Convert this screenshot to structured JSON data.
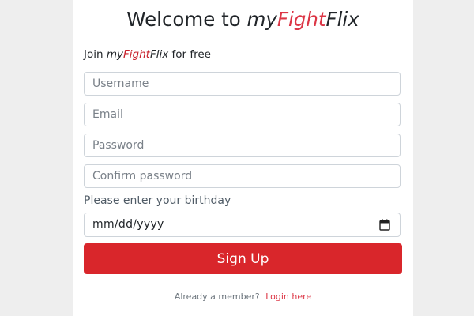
{
  "header": {
    "welcome_text": "Welcome to",
    "brand": {
      "my": "my",
      "fight": "Fight",
      "flix": "Flix"
    }
  },
  "join": {
    "prefix": "Join",
    "brand": {
      "my": "my",
      "fight": "Fight",
      "flix": "Flix"
    },
    "suffix": "for free"
  },
  "form": {
    "username_placeholder": "Username",
    "email_placeholder": "Email",
    "password_placeholder": "Password",
    "confirm_password_placeholder": "Confirm password",
    "birthday_label": "Please enter your birthday",
    "birthday_value_text": "mm/dd/yyyy",
    "submit_label": "Sign Up"
  },
  "footer": {
    "member_text": "Already a member?",
    "login_label": "Login here"
  },
  "colors": {
    "brand_red": "#dc3545",
    "button_red": "#d9262b",
    "page_background": "#eeeeee",
    "card_background": "#ffffff"
  },
  "icons": {
    "calendar": "calendar-icon"
  }
}
